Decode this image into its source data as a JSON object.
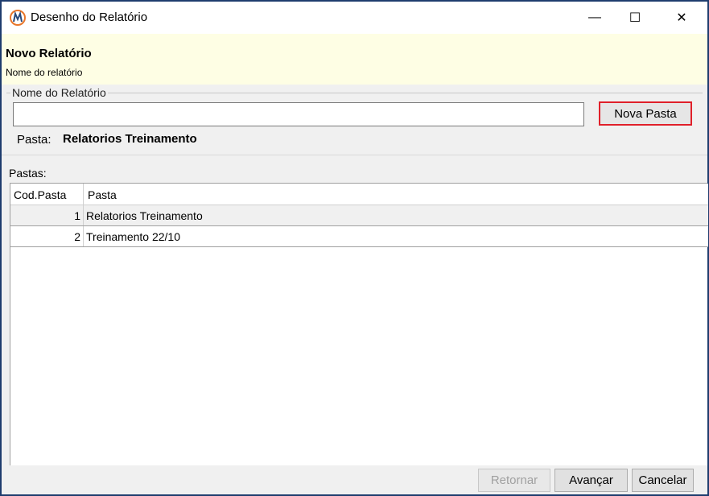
{
  "window": {
    "title": "Desenho do Relatório",
    "minimize_glyph": "—",
    "maximize_glyph": "☐",
    "close_glyph": "✕"
  },
  "header": {
    "title": "Novo Relatório",
    "subtitle": "Nome do relatório"
  },
  "form": {
    "group_label": "Nome do Relatório",
    "name_value": "",
    "nova_pasta_label": "Nova Pasta",
    "pasta_label": "Pasta:",
    "pasta_value": "Relatorios Treinamento"
  },
  "grid": {
    "label": "Pastas:",
    "columns": [
      "Cod.Pasta",
      "Pasta"
    ],
    "rows": [
      {
        "cod": "1",
        "pasta": "Relatorios Treinamento"
      },
      {
        "cod": "2",
        "pasta": "Treinamento 22/10"
      }
    ]
  },
  "footer": {
    "retornar": "Retornar",
    "avancar": "Avançar",
    "cancelar": "Cancelar"
  },
  "colors": {
    "header_bg": "#fefee4",
    "highlight_border": "#e0202a",
    "app_icon": "#e8762a"
  }
}
